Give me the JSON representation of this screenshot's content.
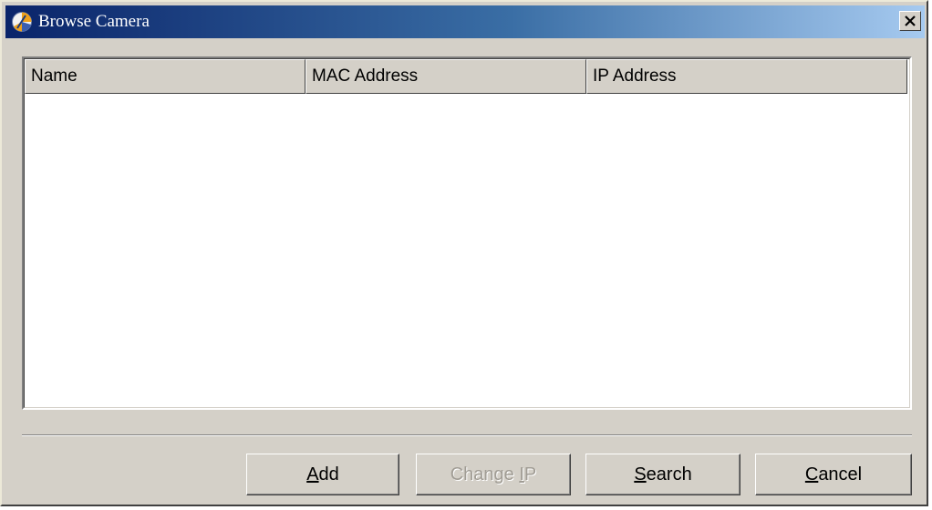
{
  "window": {
    "title": "Browse Camera",
    "close_label": "✕"
  },
  "listview": {
    "columns": [
      "Name",
      "MAC Address",
      "IP Address"
    ],
    "rows": []
  },
  "buttons": {
    "add": {
      "mnemonic": "A",
      "rest": "dd",
      "enabled": true
    },
    "change_ip": {
      "pre": "Change ",
      "mnemonic": "I",
      "rest": "P",
      "enabled": false
    },
    "search": {
      "mnemonic": "S",
      "rest": "earch",
      "enabled": true
    },
    "cancel": {
      "mnemonic": "C",
      "rest": "ancel",
      "enabled": true
    }
  }
}
